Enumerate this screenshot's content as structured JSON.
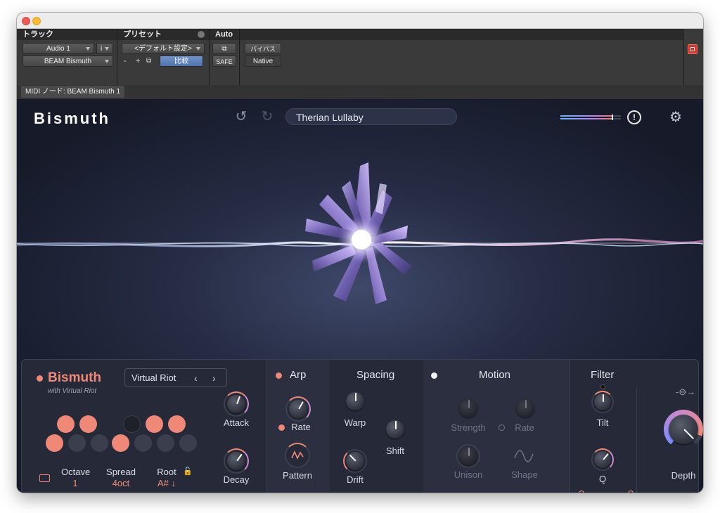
{
  "host": {
    "track_header": "トラック",
    "preset_header": "プリセット",
    "auto_header": "Auto",
    "track_name": "Audio 1",
    "info_btn": "i",
    "plugin_select": "BEAM Bismuth",
    "preset_select": "<デフォルト設定>",
    "minus": "-",
    "plus": "+",
    "compare": "比較",
    "safe": "SAFE",
    "bypass": "バイパス",
    "native": "Native",
    "midi_tab": "MIDI ノード: BEAM Bismuth 1"
  },
  "plugin": {
    "brand": "Bismuth",
    "preset_name": "Therian Lullaby",
    "accent_color": "#ef8877"
  },
  "panel": {
    "engine": {
      "title": "Bismuth",
      "subtitle": "with Virtual Riot",
      "artist_selector": "Virtual Riot",
      "octave_label": "Octave",
      "octave_value": "1",
      "spread_label": "Spread",
      "spread_value": "4oct",
      "root_label": "Root",
      "root_value": "A# ↓",
      "attack_label": "Attack",
      "decay_label": "Decay"
    },
    "arp": {
      "title": "Arp",
      "rate_label": "Rate",
      "pattern_label": "Pattern"
    },
    "spacing": {
      "title": "Spacing",
      "warp_label": "Warp",
      "shift_label": "Shift",
      "drift_label": "Drift"
    },
    "motion": {
      "title": "Motion",
      "strength_label": "Strength",
      "rate_label": "Rate",
      "unison_label": "Unison",
      "shape_label": "Shape"
    },
    "filter": {
      "title": "Filter",
      "tilt_label": "Tilt",
      "q_label": "Q",
      "depth_label": "Depth"
    }
  }
}
